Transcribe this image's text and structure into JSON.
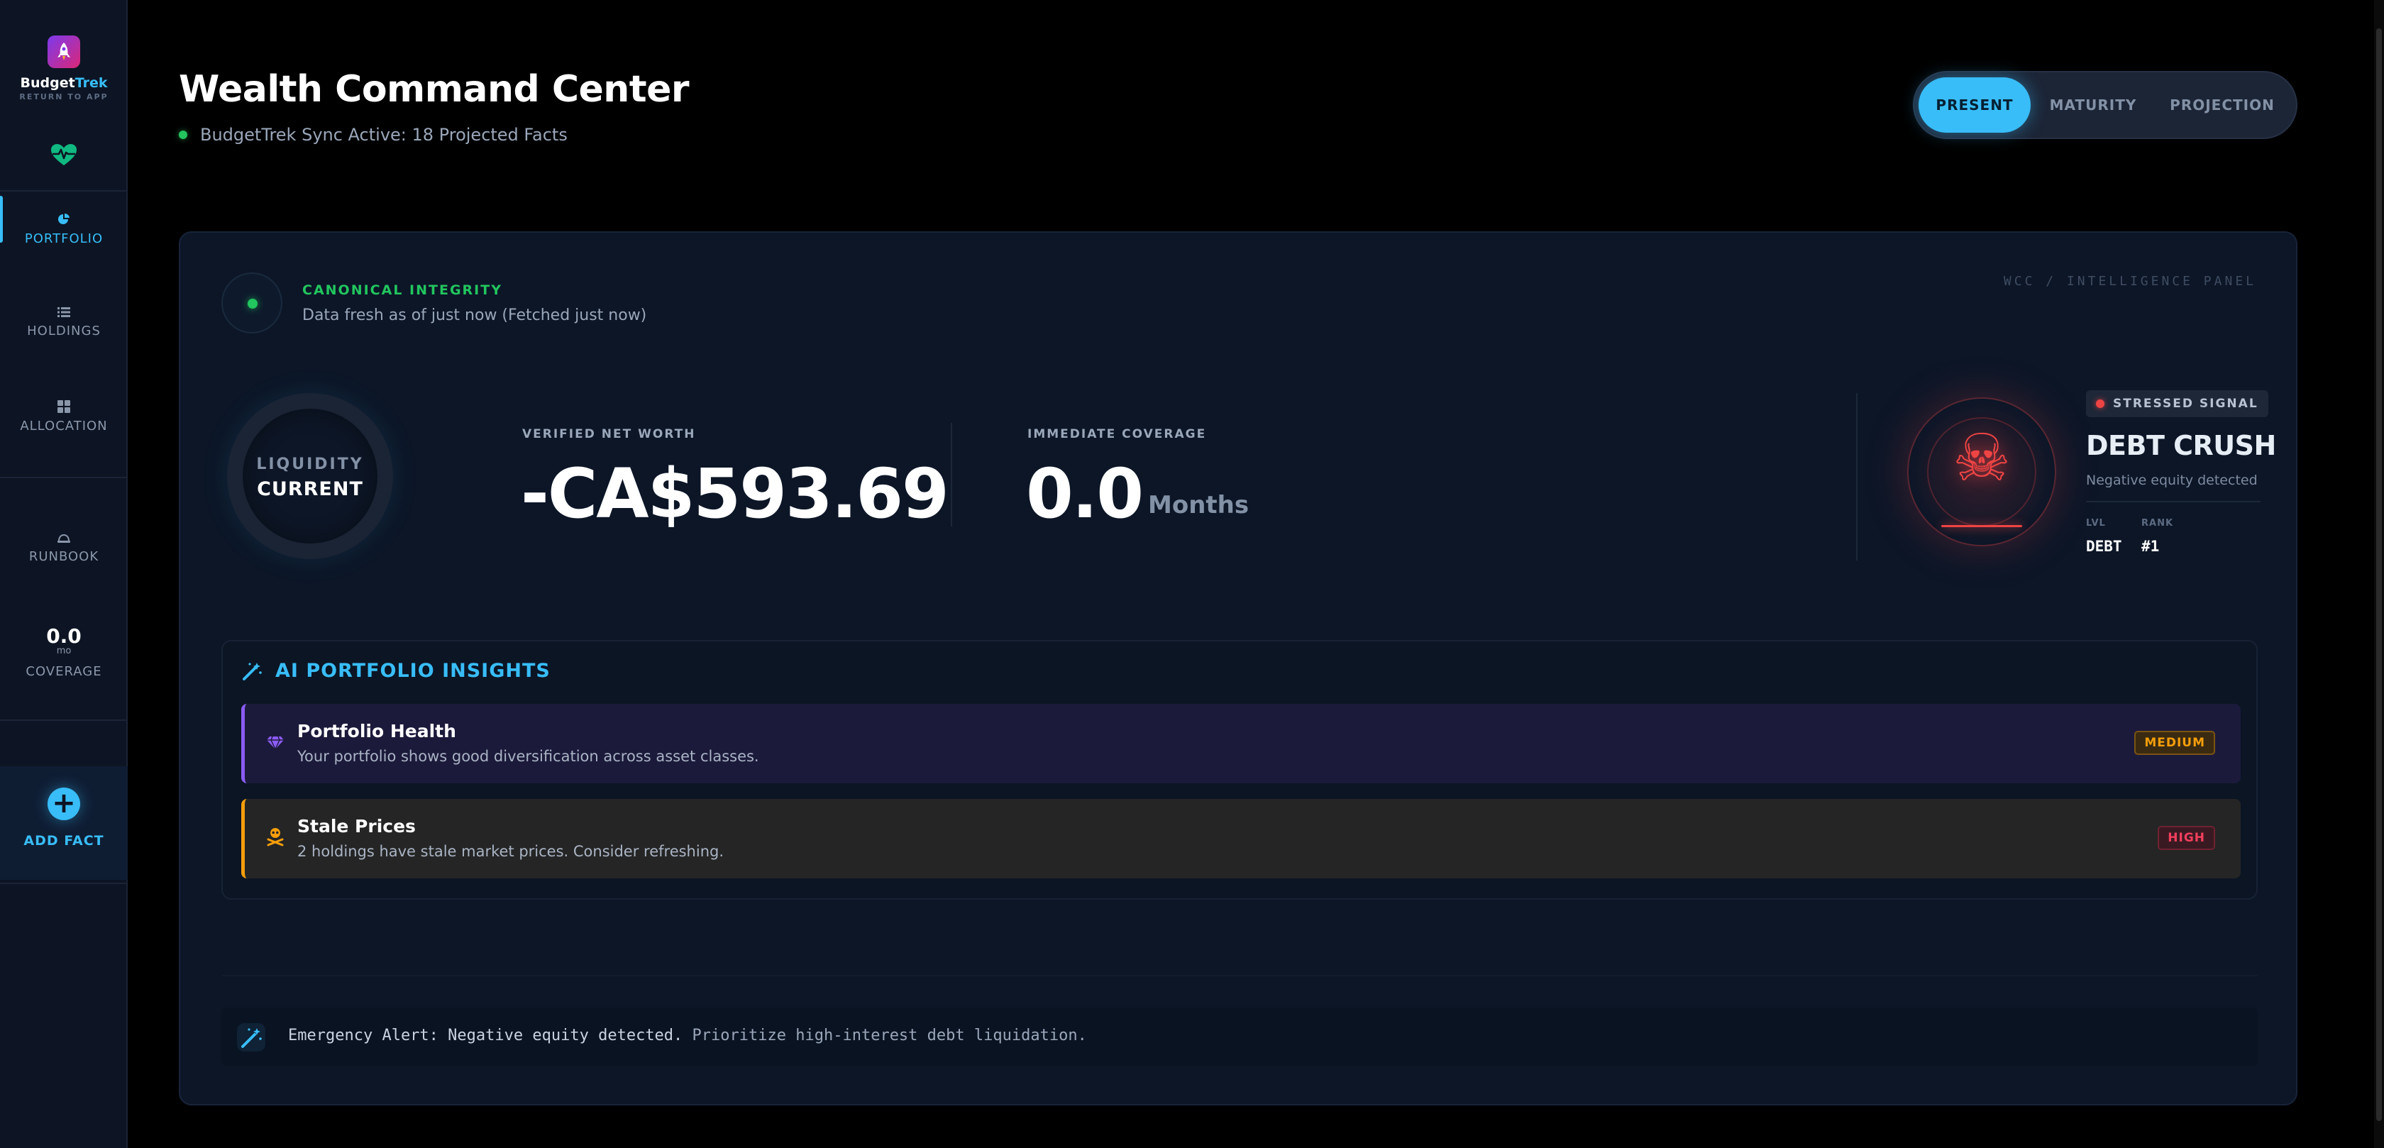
{
  "sidebar": {
    "brand_prefix": "Budget",
    "brand_suffix": "Trek",
    "brand_sub": "RETURN TO APP",
    "nav": [
      {
        "label": "PORTFOLIO",
        "icon": "pie-chart-icon",
        "active": true
      },
      {
        "label": "HOLDINGS",
        "icon": "list-icon",
        "active": false
      },
      {
        "label": "ALLOCATION",
        "icon": "grid-icon",
        "active": false
      },
      {
        "label": "RUNBOOK",
        "icon": "hardhat-icon",
        "active": false
      }
    ],
    "coverage_value": "0.0",
    "coverage_unit": "mo",
    "coverage_label": "COVERAGE",
    "add_fact_label": "ADD FACT"
  },
  "header": {
    "title": "Wealth Command Center",
    "sync_status": "BudgetTrek Sync Active: 18 Projected Facts",
    "modes": [
      "PRESENT",
      "MATURITY",
      "PROJECTION"
    ],
    "active_mode": "PRESENT"
  },
  "panel": {
    "integrity_title": "CANONICAL INTEGRITY",
    "integrity_sub": "Data fresh as of just now (Fetched just now)",
    "tag": "WCC / INTELLIGENCE PANEL",
    "liquidity_label": "LIQUIDITY",
    "liquidity_value": "CURRENT",
    "net_worth_label": "VERIFIED NET WORTH",
    "net_worth_value": "-CA$593.69",
    "coverage_label": "IMMEDIATE COVERAGE",
    "coverage_value": "0.0",
    "coverage_unit": "Months",
    "signal_badge": "STRESSED SIGNAL",
    "signal_title": "DEBT CRUSH",
    "signal_sub": "Negative equity detected",
    "lvl_label": "LVL",
    "lvl_value": "DEBT",
    "rank_label": "RANK",
    "rank_value": "#1"
  },
  "insights": {
    "heading": "AI PORTFOLIO INSIGHTS",
    "items": [
      {
        "title": "Portfolio Health",
        "desc": "Your portfolio shows good diversification across asset classes.",
        "badge": "MEDIUM",
        "icon": "gem-icon",
        "accent": "#8b5cf6"
      },
      {
        "title": "Stale Prices",
        "desc": "2 holdings have stale market prices. Consider refreshing.",
        "badge": "HIGH",
        "icon": "skull-icon",
        "accent": "#f59e0b"
      }
    ]
  },
  "alert": {
    "lead": "Emergency Alert: Negative equity detected.",
    "rest": " Prioritize high-interest debt liquidation."
  },
  "colors": {
    "accent": "#38bdf8",
    "success": "#22c55e",
    "danger": "#ef4444",
    "warning": "#f59e0b",
    "purple": "#8b5cf6"
  }
}
